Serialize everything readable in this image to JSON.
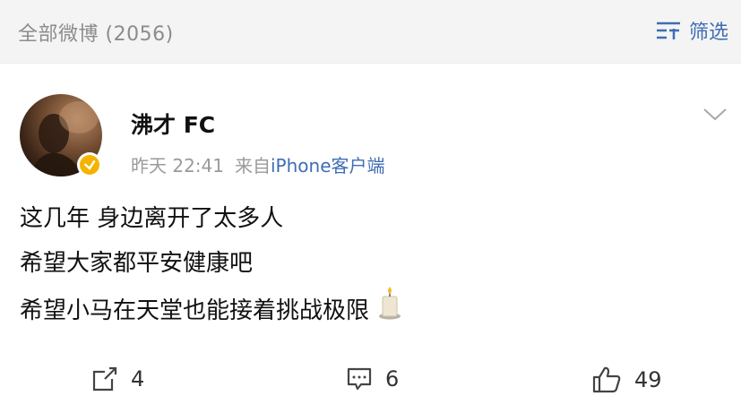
{
  "header": {
    "all_posts_label": "全部微博 (2056)",
    "filter_label": "筛选"
  },
  "post": {
    "username": "沸才 FC",
    "time": "昨天 22:41",
    "source_prefix": "来自",
    "source": "iPhone客户端",
    "lines": [
      "这几年 身边离开了太多人",
      "希望大家都平安健康吧",
      "希望小马在天堂也能接着挑战极限"
    ],
    "emoji": "candle-emoji"
  },
  "actions": {
    "repost_count": "4",
    "comment_count": "6",
    "like_count": "49"
  },
  "colors": {
    "link_blue": "#3f6db4",
    "muted_gray": "#9a9a9a",
    "verify_gold": "#f2b400"
  }
}
